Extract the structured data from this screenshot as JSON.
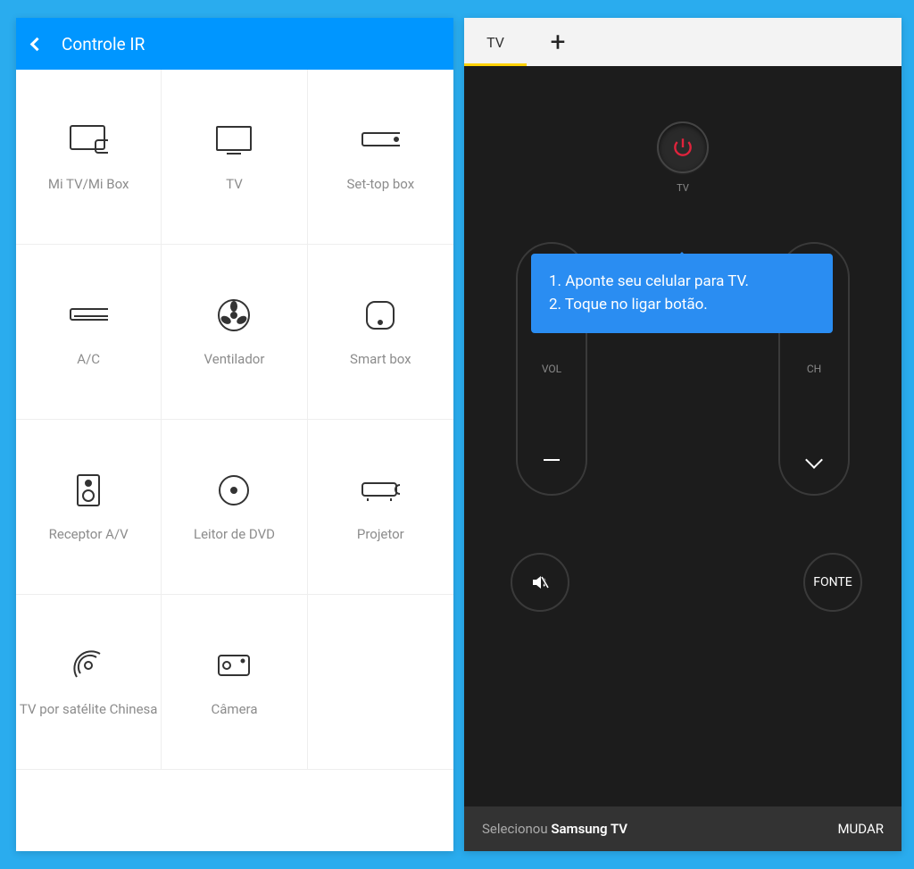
{
  "left": {
    "title": "Controle IR",
    "items": [
      {
        "label": "Mi TV/Mi Box",
        "icon": "mitv"
      },
      {
        "label": "TV",
        "icon": "tv"
      },
      {
        "label": "Set-top box",
        "icon": "stb"
      },
      {
        "label": "A/C",
        "icon": "ac"
      },
      {
        "label": "Ventilador",
        "icon": "fan"
      },
      {
        "label": "Smart box",
        "icon": "smartbox"
      },
      {
        "label": "Receptor A/V",
        "icon": "receiver"
      },
      {
        "label": "Leitor de DVD",
        "icon": "dvd"
      },
      {
        "label": "Projetor",
        "icon": "projector"
      },
      {
        "label": "TV por satélite\nChinesa",
        "icon": "sat"
      },
      {
        "label": "Câmera",
        "icon": "camera"
      }
    ]
  },
  "right": {
    "tab_label": "TV",
    "power_label": "TV",
    "vol_label": "VOL",
    "ch_label": "CH",
    "source_label": "FONTE",
    "tooltip_line1": "1. Aponte seu celular para TV.",
    "tooltip_line2": "2. Toque no ligar botão.",
    "footer_prefix": "Selecionou ",
    "footer_device": "Samsung TV",
    "footer_action": "MUDAR"
  }
}
